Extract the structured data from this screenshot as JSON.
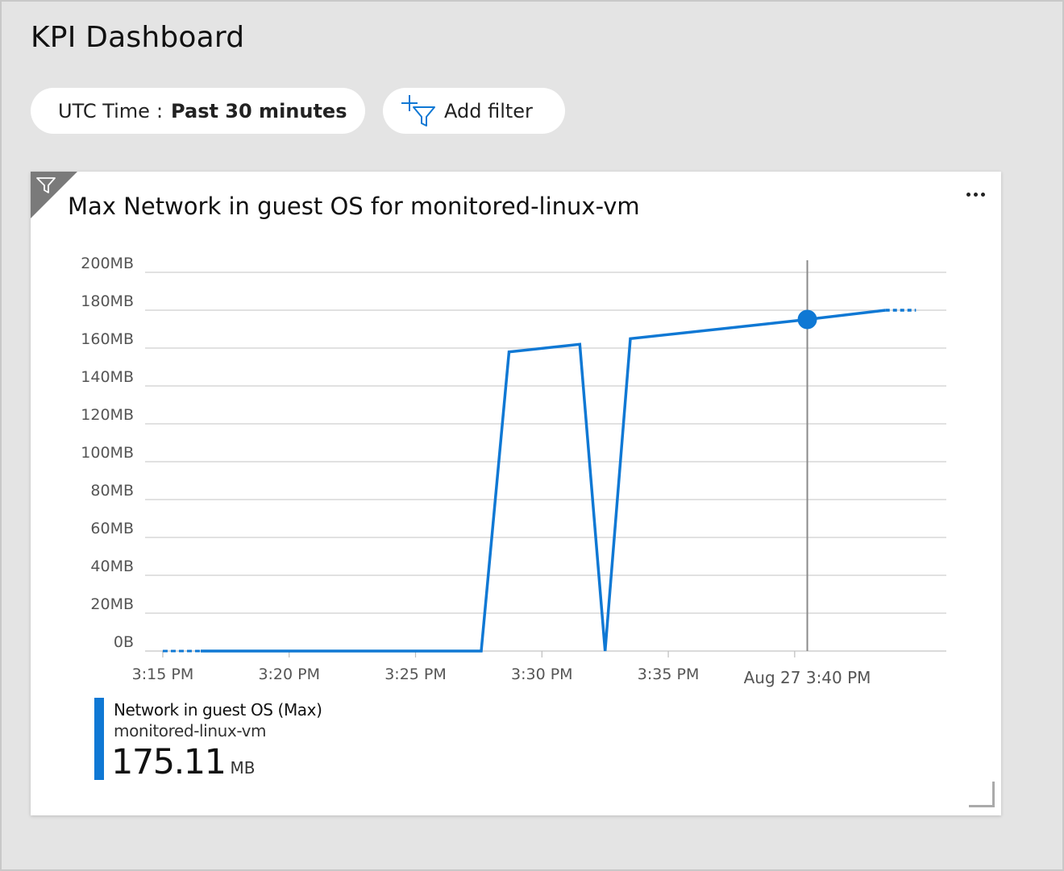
{
  "page": {
    "title": "KPI Dashboard"
  },
  "filters": {
    "time_label": "UTC Time",
    "time_separator": ":",
    "time_value": "Past 30 minutes",
    "add_filter_label": "Add filter",
    "add_filter_icon": "add-filter-icon"
  },
  "tile": {
    "title": "Max Network in guest OS for monitored-linux-vm",
    "menu_icon": "more-icon",
    "corner_icon": "filter-icon",
    "legend": {
      "metric": "Network in guest OS (Max)",
      "resource": "monitored-linux-vm",
      "value": "175.11",
      "unit": "MB"
    }
  },
  "colors": {
    "series": "#0f78d4",
    "grid": "#cfcfcf",
    "background": "#e4e4e4"
  },
  "chart_data": {
    "type": "line",
    "y_ticks": [
      "0B",
      "20MB",
      "40MB",
      "60MB",
      "80MB",
      "100MB",
      "120MB",
      "140MB",
      "160MB",
      "180MB",
      "200MB"
    ],
    "ylim": [
      0,
      200
    ],
    "x_ticks": [
      "3:15 PM",
      "3:20 PM",
      "3:25 PM",
      "3:30 PM",
      "3:35 PM",
      "3:40 PM"
    ],
    "xlim_minutes_after_3pm": [
      15,
      45
    ],
    "series": [
      {
        "name": "Network in guest OS (Max)",
        "x_minutes_after_3pm": [
          15,
          16.5,
          27.6,
          28.7,
          31.5,
          32.5,
          33.5,
          40.5,
          43.6
        ],
        "values": [
          0,
          0,
          0,
          158,
          162,
          0,
          165,
          175.11,
          180
        ],
        "dashed_prefix_end": 16.5,
        "dashed_suffix_to": 44.8
      }
    ],
    "cursor": {
      "x_minutes_after_3pm": 40.5,
      "value": 175.11,
      "label": "Aug 27 3:40 PM"
    },
    "grid": true
  }
}
